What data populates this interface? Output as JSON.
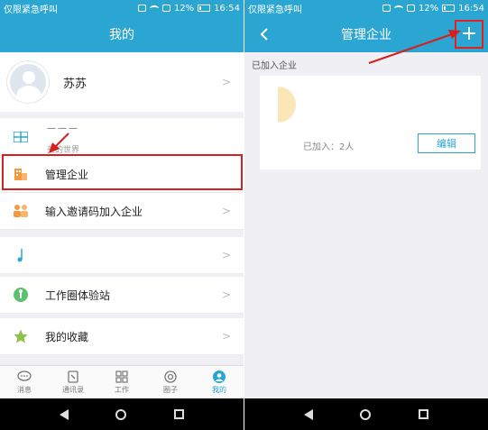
{
  "status_bar": {
    "carrier": "仅限紧急呼叫",
    "battery": "12%",
    "time": "16:54"
  },
  "left": {
    "title": "我的",
    "profile": {
      "name": "苏苏"
    },
    "org_row": {
      "top_text": "———",
      "sub_text": "美的世界"
    },
    "menu": [
      {
        "label": "管理企业",
        "icon": "building-icon"
      },
      {
        "label": "输入邀请码加入企业",
        "icon": "people-icon"
      },
      {
        "label": "",
        "icon": "music-note-icon"
      },
      {
        "label": "工作圈体验站",
        "icon": "compass-icon"
      },
      {
        "label": "我的收藏",
        "icon": "star-icon"
      }
    ],
    "tabs": [
      {
        "label": "消息",
        "icon": "chat-icon"
      },
      {
        "label": "通讯录",
        "icon": "contacts-icon"
      },
      {
        "label": "工作",
        "icon": "grid-icon"
      },
      {
        "label": "圈子",
        "icon": "circle-icon"
      },
      {
        "label": "我的",
        "icon": "person-icon"
      }
    ],
    "colors": {
      "accent": "#2ba5d2",
      "highlight": "#d62020"
    }
  },
  "right": {
    "title": "管理企业",
    "section": "已加入企业",
    "joined_text": "已加入：2人",
    "edit_label": "编辑",
    "add_label": "+"
  }
}
